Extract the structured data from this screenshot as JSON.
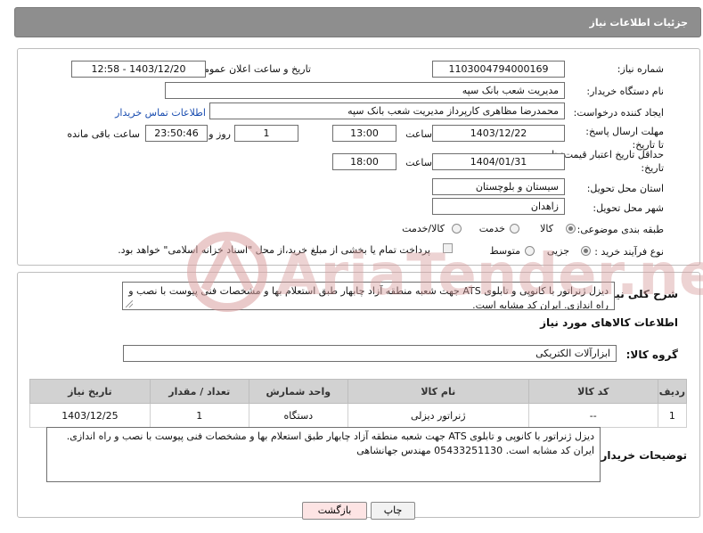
{
  "header": {
    "title": "جزئیات اطلاعات نیاز"
  },
  "form": {
    "need_number_label": "شماره نیاز:",
    "need_number_value": "1103004794000169",
    "announce_label": "تاریخ و ساعت اعلان عمومی:",
    "announce_value": "1403/12/20 - 12:58",
    "buyer_org_label": "نام دستگاه خریدار:",
    "buyer_org_value": "مدیریت شعب بانک سپه",
    "creator_label": "ایجاد کننده درخواست:",
    "creator_value": "محمدرضا مظاهری کارپرداز مدیریت شعب بانک سپه",
    "contact_link": "اطلاعات تماس خریدار",
    "reply_deadline_label": "مهلت ارسال پاسخ: تا تاریخ:",
    "reply_date": "1403/12/22",
    "time_label": "ساعت",
    "reply_time": "13:00",
    "days_value": "1",
    "days_label": "روز و",
    "remaining_value": "23:50:46",
    "remaining_label": "ساعت باقی مانده",
    "price_validity_label": "حداقل تاریخ اعتبار قیمت: تا تاریخ:",
    "price_date": "1404/01/31",
    "price_time": "18:00",
    "province_label": "استان محل تحویل:",
    "province_value": "سیستان و بلوچستان",
    "city_label": "شهر محل تحویل:",
    "city_value": "زاهدان",
    "category_label": "طبقه بندی موضوعی:",
    "category_options": [
      "کالا",
      "خدمت",
      "کالا/خدمت"
    ],
    "category_selected": "کالا",
    "process_label": "نوع فرآیند خرید :",
    "process_options": [
      "جزیی",
      "متوسط"
    ],
    "process_selected": "جزیی",
    "payment_note": "پرداخت تمام یا بخشی از مبلغ خرید،از محل \"اسناد خزانه اسلامی\" خواهد بود."
  },
  "description": {
    "label": "شرح کلی نیاز:",
    "text": "دیزل ژنراتور با کانوپی و تابلوی ATS جهت شعبه منطقه آزاد چابهار طبق استعلام بها و مشخصات فنی پیوست با نصب و راه اندازی. ایران کد مشابه است."
  },
  "goods": {
    "section_title": "اطلاعات کالاهای مورد نیاز",
    "group_label": "گروه کالا:",
    "group_value": "ابزارآلات الکتریکی",
    "columns": [
      "ردیف",
      "کد کالا",
      "نام کالا",
      "واحد شمارش",
      "تعداد / مقدار",
      "تاریخ نیاز"
    ],
    "rows": [
      {
        "row": "1",
        "code": "--",
        "name": "ژنراتور دیزلی",
        "unit": "دستگاه",
        "qty": "1",
        "date": "1403/12/25"
      }
    ]
  },
  "buyer_notes": {
    "label": "توضیحات خریدار:",
    "text": "دیزل ژنراتور با کانوپی و تابلوی ATS جهت شعبه منطقه آزاد چابهار طبق استعلام بها و مشخصات فنی پیوست با نصب و راه اندازی. ایران کد مشابه است. 05433251130 مهندس جهانشاهی"
  },
  "buttons": {
    "print": "چاپ",
    "back": "بازگشت"
  },
  "watermark": "AriaTender.neT",
  "colors": {
    "header_bg": "#8e8e8e",
    "table_header_bg": "#d2d2d2",
    "link": "#1a4db0",
    "back_button_bg": "#fde4e4",
    "watermark": "#d9a0a0"
  }
}
